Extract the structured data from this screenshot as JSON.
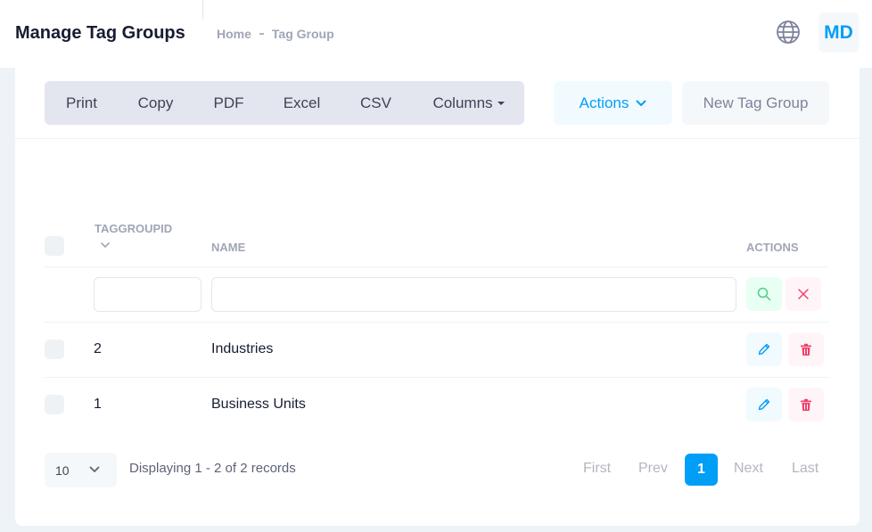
{
  "header": {
    "title": "Manage Tag Groups",
    "breadcrumb": [
      "Home",
      "Tag Group"
    ],
    "avatar_initials": "MD"
  },
  "toolbar": {
    "export_buttons": [
      "Print",
      "Copy",
      "PDF",
      "Excel",
      "CSV"
    ],
    "columns_label": "Columns",
    "actions_label": "Actions",
    "new_label": "New Tag Group"
  },
  "table": {
    "columns": [
      "TAGGROUPID",
      "NAME",
      "ACTIONS"
    ],
    "rows": [
      {
        "id": "2",
        "name": "Industries"
      },
      {
        "id": "1",
        "name": "Business Units"
      }
    ]
  },
  "footer": {
    "page_size": "10",
    "display_info": "Displaying 1 - 2 of 2 records",
    "pager": {
      "first": "First",
      "prev": "Prev",
      "current": "1",
      "next": "Next",
      "last": "Last"
    }
  },
  "colors": {
    "accent": "#009ef7",
    "danger": "#f1416c",
    "success": "#50cd89"
  },
  "icons": [
    "globe-icon",
    "chevron-down-icon",
    "sort-chevron-icon",
    "search-icon",
    "close-icon",
    "pencil-icon",
    "trash-icon"
  ]
}
